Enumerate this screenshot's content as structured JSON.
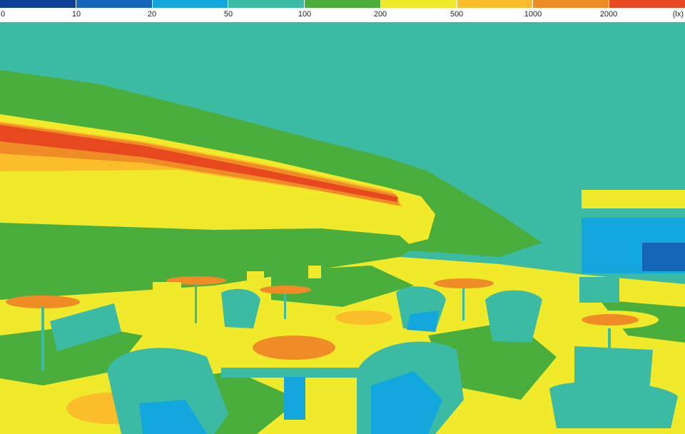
{
  "legend": {
    "unit": "(lx)",
    "levels": [
      {
        "label": "0",
        "color": "#0d3f95"
      },
      {
        "label": "10",
        "color": "#1565b8"
      },
      {
        "label": "20",
        "color": "#12a7dd"
      },
      {
        "label": "50",
        "color": "#3bbba3"
      },
      {
        "label": "100",
        "color": "#4aae3c"
      },
      {
        "label": "200",
        "color": "#f0ea2a"
      },
      {
        "label": "500",
        "color": "#fbbd2a"
      },
      {
        "label": "1000",
        "color": "#f08c26"
      },
      {
        "label": "2000",
        "color": "#e8481f"
      }
    ]
  },
  "colors": {
    "teal": "#3bbba3",
    "green": "#4aae3c",
    "yellow": "#f0ea2a",
    "amber": "#fbbd2a",
    "orange": "#f08c26",
    "red": "#e8481f",
    "blue": "#12a7dd",
    "navy": "#1565b8"
  }
}
